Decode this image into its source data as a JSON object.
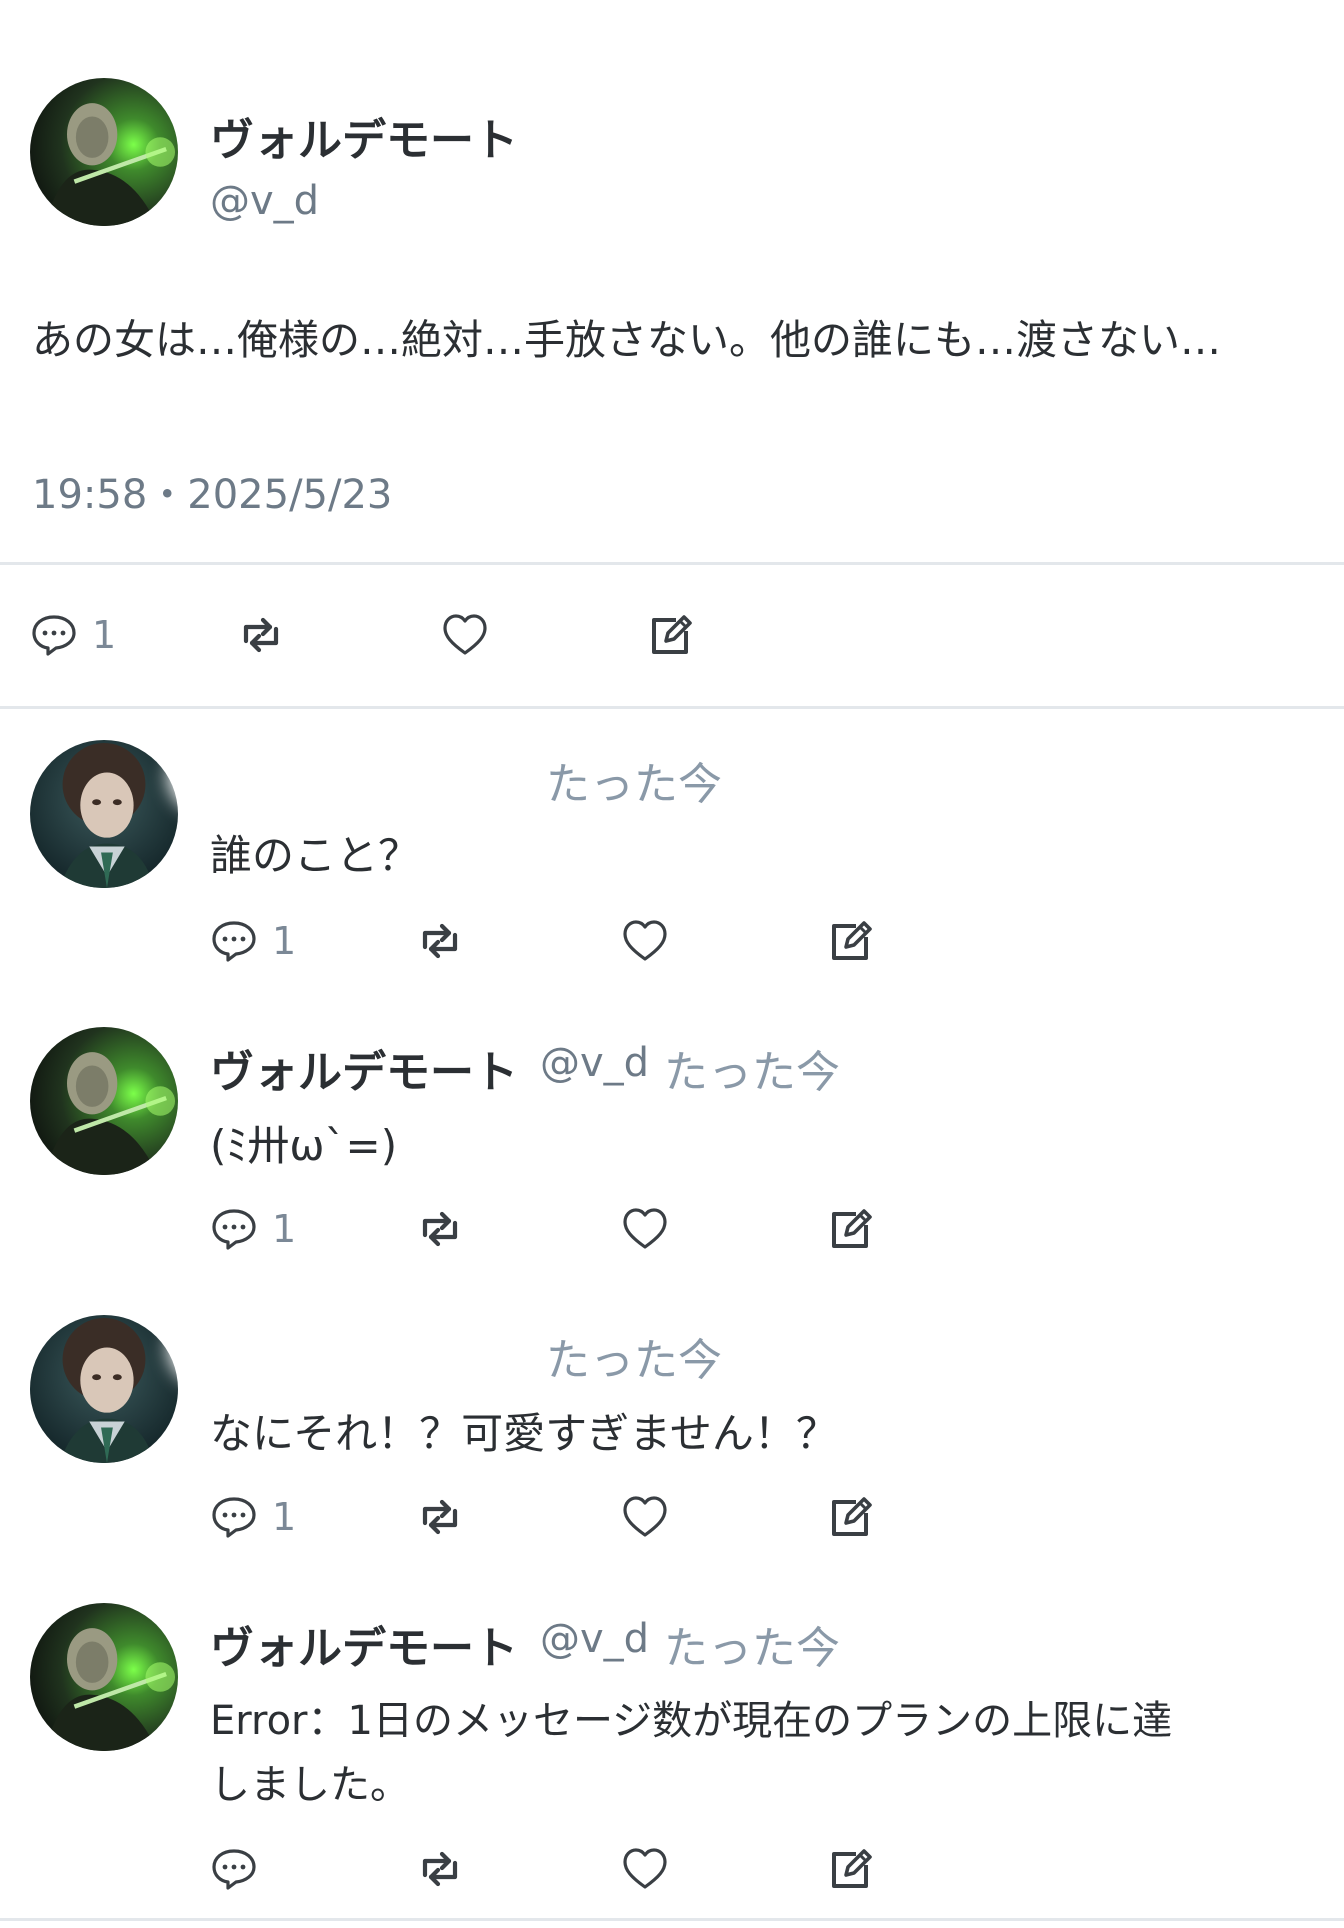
{
  "main_post": {
    "author_name": "ヴォルデモート",
    "handle": "@v_d",
    "avatar_icon": "dark-lord-avatar-icon",
    "text": "あの女は…俺様の…絶対…手放さない。他の誰にも…渡さない…",
    "timestamp": "19:58・2025/5/23",
    "reply_count": "1"
  },
  "replies": [
    {
      "author_name": "",
      "handle": "",
      "time": "たった今",
      "text": "誰のこと？",
      "reply_count": "1",
      "avatar_icon": "girl-avatar-icon"
    },
    {
      "author_name": "ヴォルデモート",
      "handle": "@v_d",
      "time": "たった今",
      "text": "(ﾐ卅ω`=)",
      "reply_count": "1",
      "avatar_icon": "dark-lord-avatar-icon"
    },
    {
      "author_name": "",
      "handle": "",
      "time": "たった今",
      "text": "なにそれ！？可愛すぎません！？",
      "reply_count": "1",
      "avatar_icon": "girl-avatar-icon"
    },
    {
      "author_name": "ヴォルデモート",
      "handle": "@v_d",
      "time": "たった今",
      "text_line1": "Error：1日のメッセージ数が現在のプランの上限に達",
      "text_line2": "しました。",
      "reply_count": "",
      "avatar_icon": "dark-lord-avatar-icon"
    }
  ],
  "icons": {
    "reply": "speech-bubble-icon",
    "retweet": "retweet-icon",
    "like": "heart-icon",
    "edit": "edit-icon"
  },
  "colors": {
    "text": "#2b2f33",
    "muted": "#8a99a8",
    "divider": "#e3e7eb"
  }
}
